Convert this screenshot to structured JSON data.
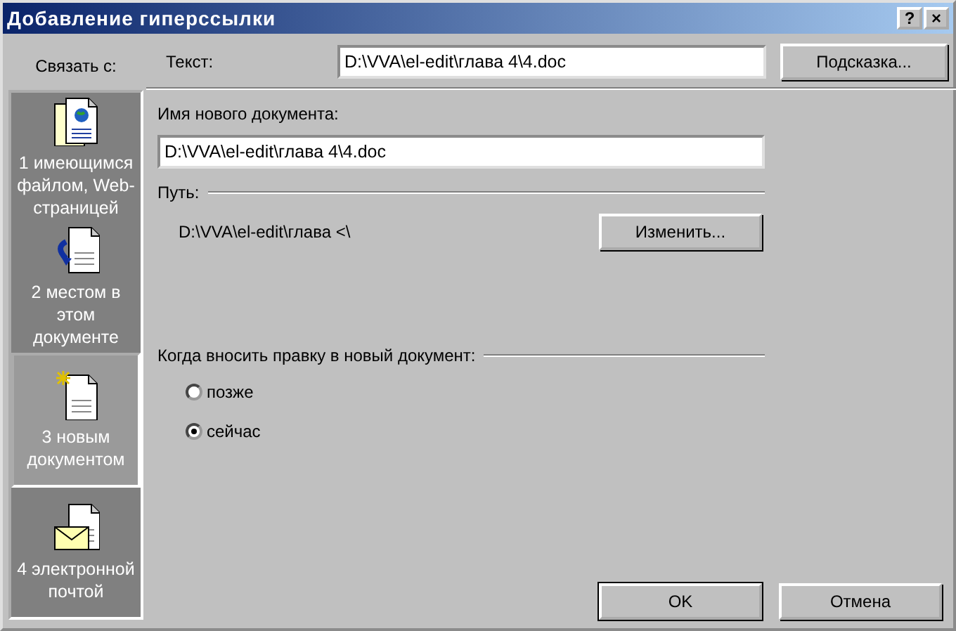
{
  "window": {
    "title": "Добавление гиперссылки",
    "title_buttons": [
      "?",
      "×"
    ]
  },
  "link_to_label": "Связать с:",
  "sidebar": {
    "items": [
      {
        "kind": "file",
        "label": "1 имеющимся файлом, Web-страницей",
        "selected": false
      },
      {
        "kind": "place",
        "label": "2 местом в этом документе",
        "selected": false
      },
      {
        "kind": "new",
        "label": "3 новым документом",
        "selected": true
      },
      {
        "kind": "mail",
        "label": "4 электронной почтой",
        "selected": false
      }
    ]
  },
  "text_field": {
    "label": "Текст:",
    "value": "D:\\VVA\\el-edit\\глава 4\\4.doc"
  },
  "hint_button": "Подсказка...",
  "new_doc": {
    "label": "Имя нового документа:",
    "value": "D:\\VVA\\el-edit\\глава 4\\4.doc"
  },
  "path": {
    "label": "Путь:",
    "value": "D:\\VVA\\el-edit\\глава <\\"
  },
  "change_button": "Изменить...",
  "edit_when": {
    "label": "Когда вносить правку в новый документ:",
    "options": [
      {
        "label": "позже",
        "selected": false
      },
      {
        "label": "сейчас",
        "selected": true
      }
    ]
  },
  "buttons": [
    "OK",
    "Отмена"
  ]
}
